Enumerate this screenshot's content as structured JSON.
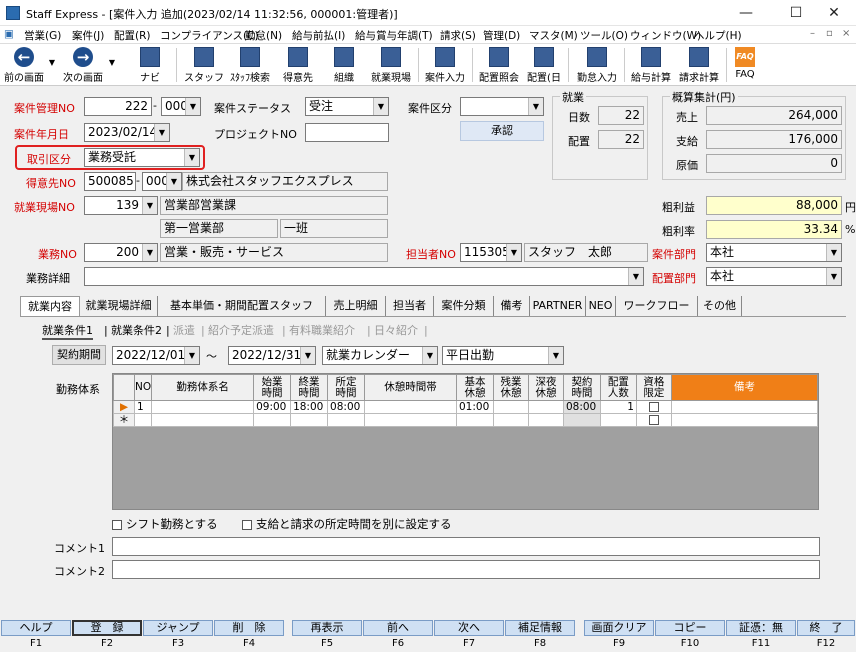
{
  "window": {
    "title": "Staff Express - [案件入力 追加(2023/02/14 11:32:56, 000001:管理者)]",
    "min": "—",
    "max": "☐",
    "close": "✕"
  },
  "menu": [
    "営業(G)",
    "案件(J)",
    "配置(R)",
    "コンプライアンス(C)",
    "勤怠(N)",
    "給与前払(I)",
    "給与賞与年調(T)",
    "請求(S)",
    "管理(D)",
    "マスタ(M)",
    "ツール(O)",
    "ウィンドウ(W)",
    "ヘルプ(H)"
  ],
  "toolbar": [
    {
      "label": "前の画面",
      "icon": "back-arrow-icon"
    },
    {
      "label": "次の画面",
      "icon": "forward-arrow-icon"
    },
    {
      "label": "ナビ",
      "icon": "navi-icon"
    },
    {
      "label": "スタッフ",
      "icon": "staff-icon"
    },
    {
      "label": "ｽﾀｯﾌ検索",
      "icon": "staff-search-icon"
    },
    {
      "label": "得意先",
      "icon": "customer-icon"
    },
    {
      "label": "組織",
      "icon": "organization-icon"
    },
    {
      "label": "就業現場",
      "icon": "worksite-icon"
    },
    {
      "label": "案件入力",
      "icon": "case-entry-icon"
    },
    {
      "label": "配置照会",
      "icon": "placement-inquiry-icon"
    },
    {
      "label": "配置(日",
      "icon": "placement-daily-icon"
    },
    {
      "label": "勤怠入力",
      "icon": "attendance-entry-icon"
    },
    {
      "label": "給与計算",
      "icon": "payroll-icon"
    },
    {
      "label": "請求計算",
      "icon": "billing-icon"
    },
    {
      "label": "FAQ",
      "icon": "faq-icon",
      "glyph": "FAQ"
    }
  ],
  "form": {
    "case_no_label": "案件管理NO",
    "case_no": "222",
    "case_no_sep": "-",
    "case_no_sub": "000",
    "status_label": "案件ステータス",
    "status": "受注",
    "category_label": "案件区分",
    "category": "",
    "approve_btn": "承認",
    "date_label": "案件年月日",
    "date": "2023/02/14",
    "project_label": "プロジェクトNO",
    "project": "",
    "trade_label": "取引区分",
    "trade": "業務受託",
    "customer_label": "得意先NO",
    "customer_no": "500085",
    "customer_sep": "-",
    "customer_sub": "000",
    "customer_name": "株式会社スタッフエクスプレス",
    "site_label": "就業現場NO",
    "site_no": "139",
    "site_name": "営業部営業課",
    "site_dept": "第一営業部",
    "site_team": "一班",
    "work_label": "業務NO",
    "work_no": "200",
    "work_name": "営業・販売・サービス",
    "rep_label": "担当者NO",
    "rep_no": "115305",
    "rep_name": "スタッフ　太郎",
    "case_dept_label": "案件部門",
    "case_dept": "本社",
    "detail_label": "業務詳細",
    "detail": "",
    "place_dept_label": "配置部門",
    "place_dept": "本社",
    "gross_label": "粗利益",
    "gross": "88,000",
    "gross_unit": "円",
    "rate_label": "粗利率",
    "rate": "33.34",
    "rate_unit": "%"
  },
  "work_box": {
    "title": "就業",
    "days_label": "日数",
    "days": "22",
    "placed_label": "配置",
    "placed": "22"
  },
  "est_box": {
    "title": "概算集計(円)",
    "sales_label": "売上",
    "sales": "264,000",
    "pay_label": "支給",
    "pay": "176,000",
    "cost_label": "原価",
    "cost": "0"
  },
  "tabs": [
    "就業内容",
    "就業現場詳細",
    "基本単価・期間配置スタッフ",
    "売上明細",
    "担当者",
    "案件分類",
    "備考",
    "PARTNER",
    "NEO",
    "ワークフロー",
    "その他"
  ],
  "subtabs": [
    "就業条件1",
    "就業条件2",
    "派遣",
    "紹介予定派遣",
    "有料職業紹介",
    "日々紹介"
  ],
  "contract": {
    "btn": "契約期間",
    "from": "2022/12/01",
    "tilde": "～",
    "to": "2022/12/31",
    "calendar": "就業カレンダー",
    "shift": "平日出勤"
  },
  "grid": {
    "label": "勤務体系",
    "headers": [
      "NO",
      "勤務体系名",
      "始業\n時間",
      "終業\n時間",
      "所定\n時間",
      "休憩時間帯",
      "基本\n休憩",
      "残業\n休憩",
      "深夜\n休憩",
      "契約\n時間",
      "配置\n人数",
      "資格\n限定",
      "備考"
    ],
    "rows": [
      {
        "marker": "▶",
        "no": "1",
        "name": "",
        "start": "09:00",
        "end": "18:00",
        "std": "08:00",
        "break_band": "",
        "basic_break": "01:00",
        "ot_break": "",
        "night_break": "",
        "contract": "08:00",
        "count": "1",
        "qual": false,
        "note": ""
      },
      {
        "marker": "＊",
        "no": "",
        "name": "",
        "start": "",
        "end": "",
        "std": "",
        "break_band": "",
        "basic_break": "",
        "ot_break": "",
        "night_break": "",
        "contract": "",
        "count": "",
        "qual": false,
        "note": ""
      }
    ]
  },
  "checks": {
    "shift": "シフト勤務とする",
    "separate": "支給と請求の所定時間を別に設定する"
  },
  "comments": {
    "c1_label": "コメント1",
    "c1": "",
    "c2_label": "コメント2",
    "c2": ""
  },
  "fkeys": [
    {
      "label": "ヘルプ",
      "key": "F1"
    },
    {
      "label": "登　録",
      "key": "F2"
    },
    {
      "label": "ジャンプ",
      "key": "F3"
    },
    {
      "label": "削　除",
      "key": "F4"
    },
    {
      "label": "再表示",
      "key": "F5"
    },
    {
      "label": "前へ",
      "key": "F6"
    },
    {
      "label": "次へ",
      "key": "F7"
    },
    {
      "label": "補足情報",
      "key": "F8"
    },
    {
      "label": "画面クリア",
      "key": "F9"
    },
    {
      "label": "コピー",
      "key": "F10"
    },
    {
      "label": "証憑：無",
      "key": "F11"
    },
    {
      "label": "終　了",
      "key": "F12"
    }
  ],
  "colors": {
    "accent_red": "#d40000",
    "highlight_box": "#e02020",
    "yellow_field": "#ffffcc",
    "remark_header": "#f07f17",
    "fkey_bg": "#cfe0f3"
  }
}
